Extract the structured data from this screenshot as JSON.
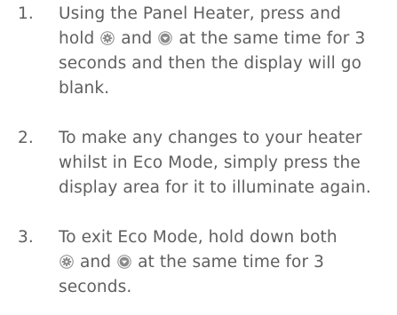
{
  "steps": [
    {
      "number": "1.",
      "line1": "Using the Panel Heater, press and",
      "line2_a": "hold",
      "line2_b": "and",
      "line2_c": "at the same time for 3",
      "line3": "seconds and then the display will go",
      "line4": "blank."
    },
    {
      "number": "2.",
      "line1": "To make any changes to your heater",
      "line2": "whilst in Eco Mode, simply press the",
      "line3": "display area for it to illuminate again."
    },
    {
      "number": "3.",
      "line1": "To exit Eco Mode, hold down both",
      "line2_b": "and",
      "line2_c": "at the same time for 3",
      "line3": "seconds."
    }
  ],
  "icons": {
    "settings": "settings-icon",
    "down": "down-arrow-icon",
    "color": "#8a8a8a"
  }
}
